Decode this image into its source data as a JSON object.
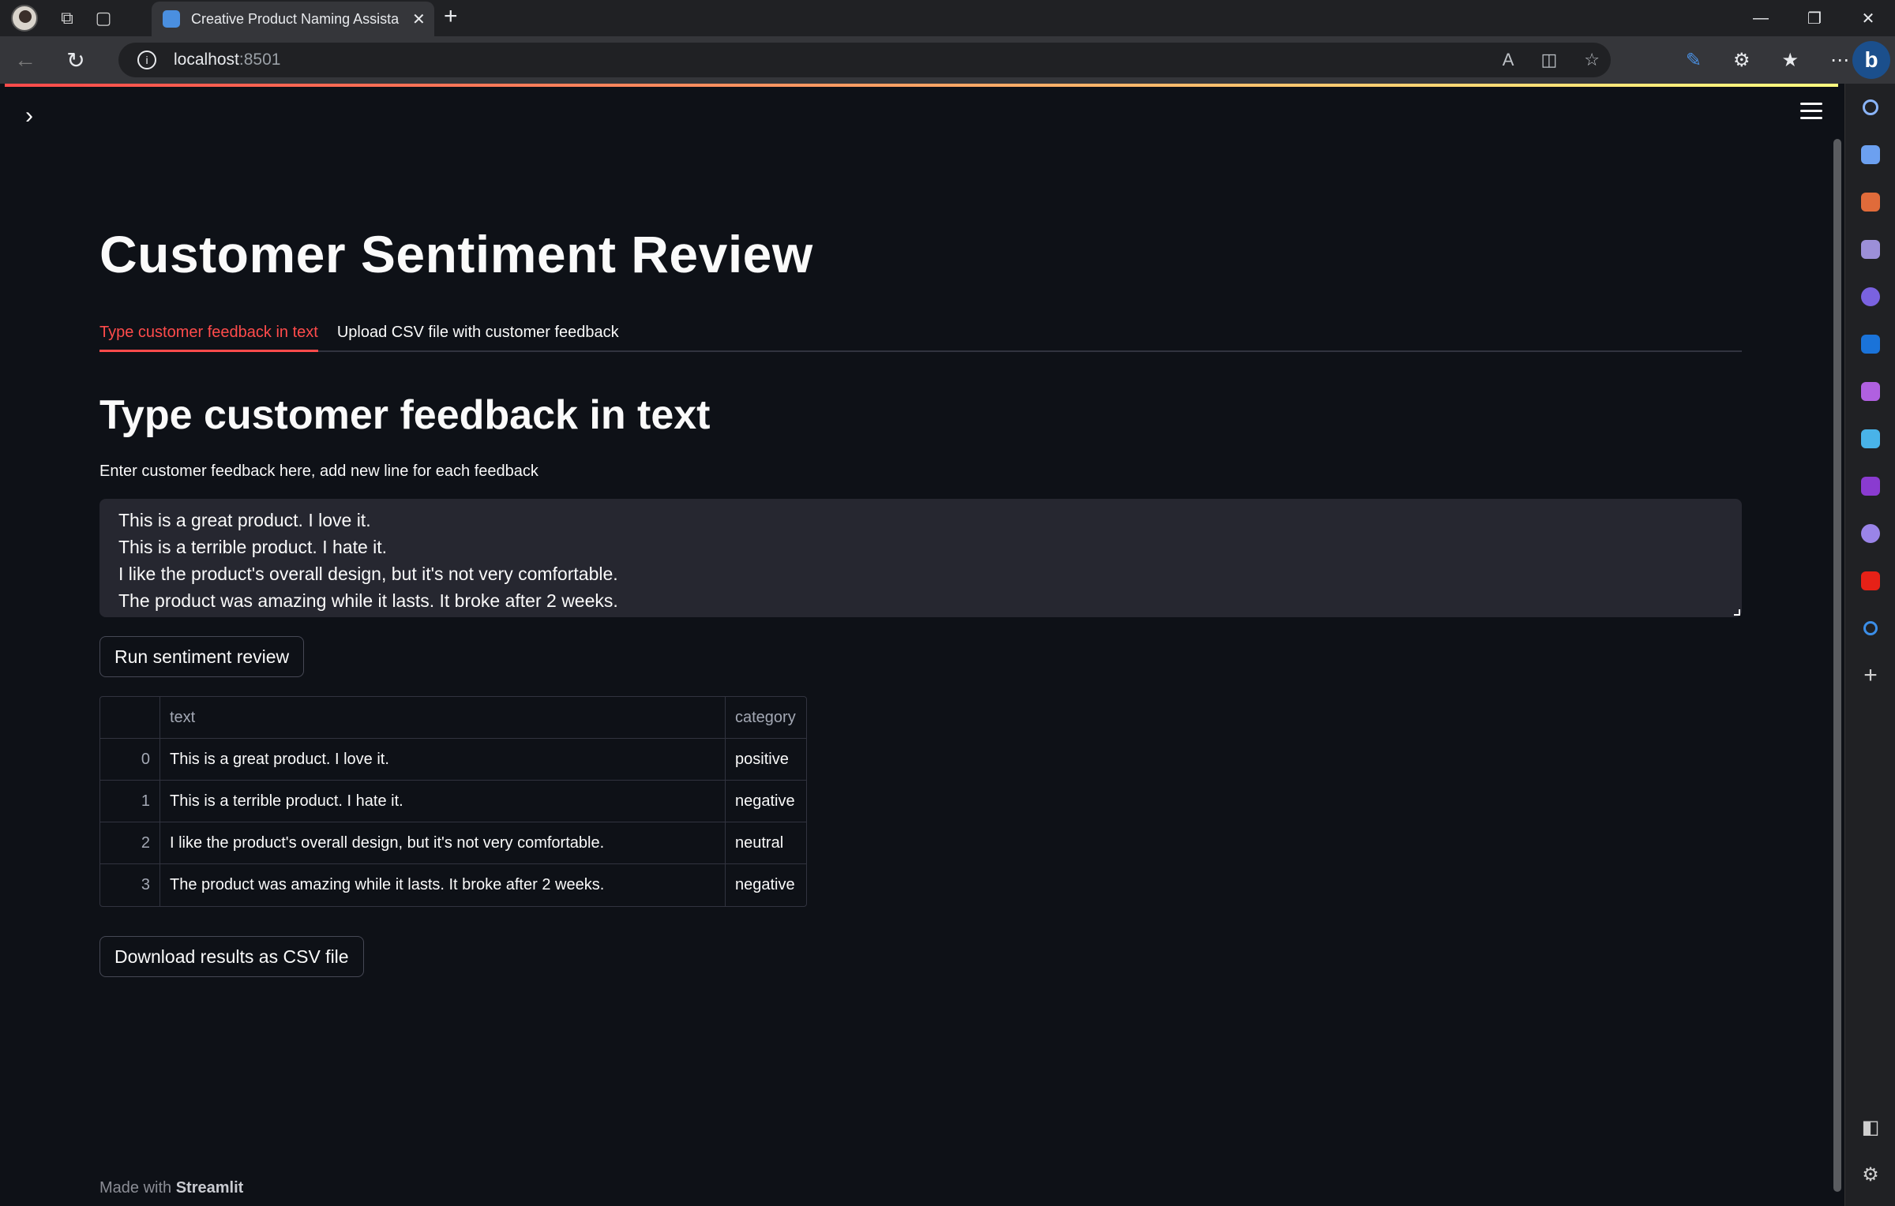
{
  "browser": {
    "tab_title": "Creative Product Naming Assista",
    "url_host": "localhost",
    "url_port": ":8501",
    "new_tab": "+",
    "close_tab": "✕"
  },
  "app": {
    "page_title": "Customer Sentiment Review",
    "tabs": [
      {
        "label": "Type customer feedback in text",
        "active": true
      },
      {
        "label": "Upload CSV file with customer feedback",
        "active": false
      }
    ],
    "section_title": "Type customer feedback in text",
    "textarea": {
      "label": "Enter customer feedback here, add new line for each feedback",
      "lines": [
        "This is a great product. I love it.",
        "This is a terrible product. I hate it.",
        "I like the product's overall design, but it's not very comfortable.",
        "The product was amazing while it lasts. It broke after 2 weeks."
      ]
    },
    "run_button": "Run sentiment review",
    "table": {
      "columns": [
        "",
        "text",
        "category"
      ],
      "rows": [
        {
          "index": "0",
          "text": "This is a great product. I love it.",
          "category": "positive"
        },
        {
          "index": "1",
          "text": "This is a terrible product. I hate it.",
          "category": "negative"
        },
        {
          "index": "2",
          "text": "I like the product's overall design, but it's not very comfortable.",
          "category": "neutral"
        },
        {
          "index": "3",
          "text": "The product was amazing while it lasts. It broke after 2 weeks.",
          "category": "negative"
        }
      ]
    },
    "download_button": "Download results as CSV file",
    "footer": {
      "prefix": "Made with",
      "brand": "Streamlit"
    }
  },
  "colors": {
    "accent": "#ff4b4b",
    "background": "#0e1117",
    "input_bg": "#262730"
  },
  "side_panel_icons": [
    "search-icon",
    "tag-icon",
    "briefcase-icon",
    "chess-icon",
    "copilot-icon",
    "outlook-icon",
    "designer-icon",
    "send-icon",
    "onenote-icon",
    "meditation-icon",
    "youtube-icon",
    "bing-search-icon",
    "add-icon"
  ]
}
